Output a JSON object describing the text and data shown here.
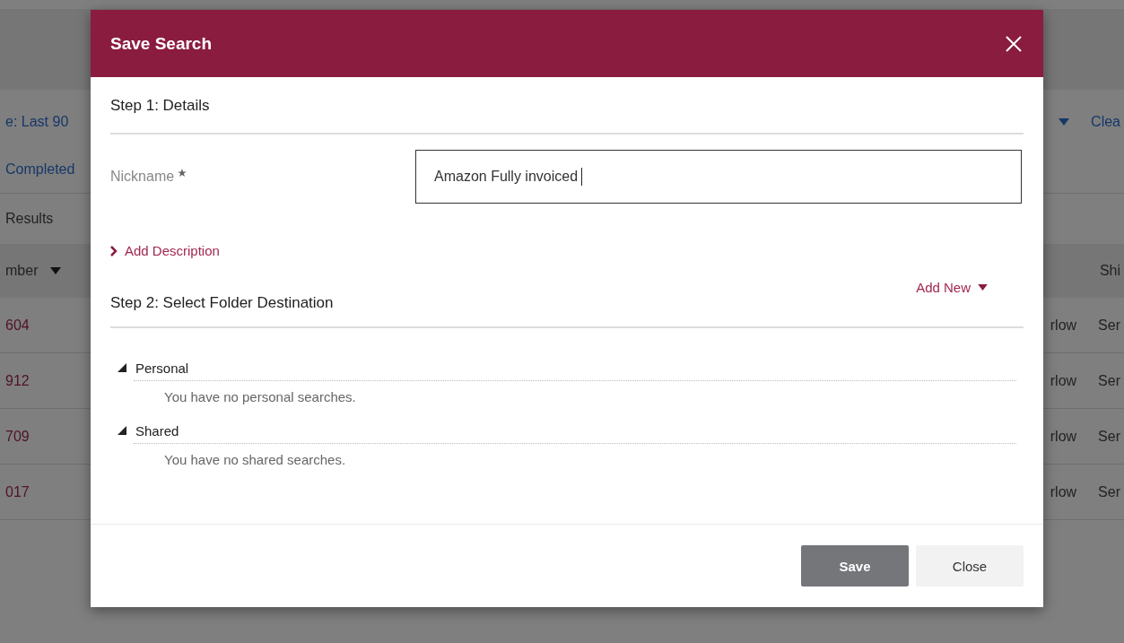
{
  "background": {
    "filter_link": "e: Last 90",
    "clear_link": "Clea",
    "status_link": "Completed",
    "results_label": "Results",
    "table": {
      "columns": [
        {
          "label": "mber",
          "sorted": true
        },
        {
          "label": "Shi"
        }
      ],
      "rows": [
        {
          "number": "604",
          "column_2": "rlow",
          "column_3": "Ser"
        },
        {
          "number": "912",
          "column_2": "rlow",
          "column_3": "Ser"
        },
        {
          "number": "709",
          "column_2": "rlow",
          "column_3": "Ser"
        },
        {
          "number": "017",
          "column_2": "rlow",
          "column_3": "Ser"
        }
      ]
    }
  },
  "dialog": {
    "title": "Save Search",
    "step1": {
      "title": "Step 1: Details",
      "nickname": {
        "label": "Nickname",
        "required": true,
        "value": "Amazon Fully invoiced",
        "focused": true
      },
      "add_description": {
        "label": "Add Description",
        "expanded": false
      }
    },
    "step2": {
      "title": "Step 2: Select Folder Destination",
      "add_new": "Add New",
      "folders": [
        {
          "name": "Personal",
          "expanded": true,
          "empty_message": "You have no personal searches."
        },
        {
          "name": "Shared",
          "expanded": true,
          "empty_message": "You have no shared searches."
        }
      ]
    },
    "buttons": [
      {
        "label": "Save",
        "kind": "primary"
      },
      {
        "label": "Close",
        "kind": "secondary"
      }
    ]
  }
}
